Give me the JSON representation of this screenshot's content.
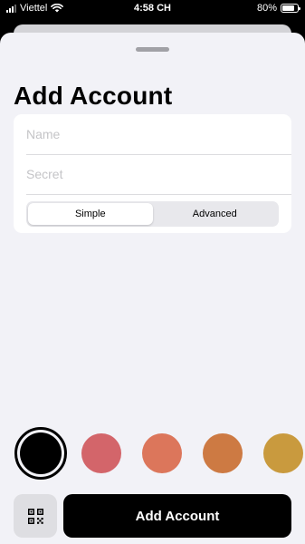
{
  "status_bar": {
    "carrier": "Viettel",
    "time": "4:58 CH",
    "battery": "80%",
    "battery_level": 0.8,
    "icons": [
      "signal-icon",
      "wifi-icon",
      "battery-icon"
    ]
  },
  "sheet": {
    "title": "Add Account",
    "fields": {
      "name": {
        "value": "",
        "placeholder": "Name"
      },
      "secret": {
        "value": "",
        "placeholder": "Secret"
      }
    },
    "mode": {
      "options": [
        "Simple",
        "Advanced"
      ],
      "selected": "Simple"
    },
    "colors": [
      "#000000",
      "#d3656a",
      "#dc765b",
      "#cd7a43",
      "#c99a3e"
    ],
    "selected_color": "#000000",
    "scan_icon": "qr-code-icon",
    "submit_label": "Add Account"
  }
}
